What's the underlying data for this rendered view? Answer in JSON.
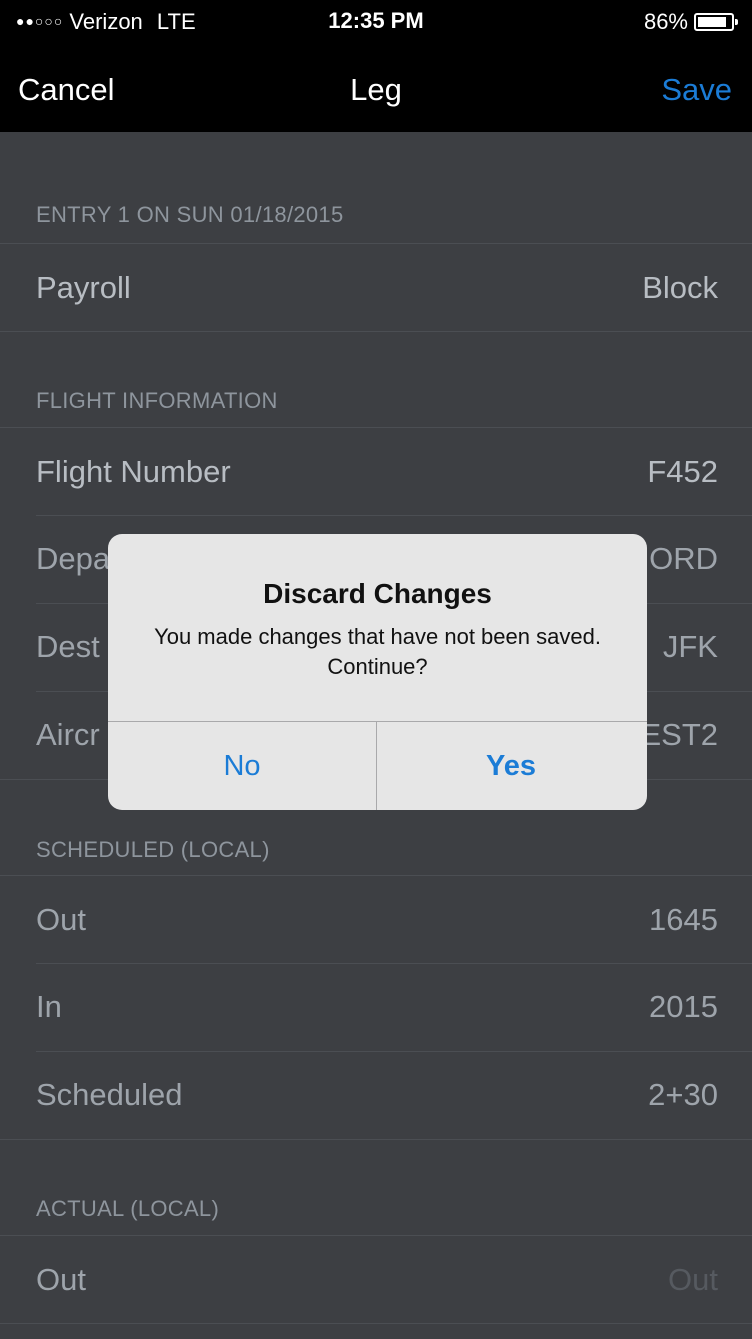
{
  "status_bar": {
    "signal": "●●○○○",
    "carrier": "Verizon",
    "network": "LTE",
    "time": "12:35 PM",
    "battery": "86%",
    "battery_level": 0.86
  },
  "nav": {
    "cancel": "Cancel",
    "title": "Leg",
    "save": "Save"
  },
  "sections": {
    "entry": {
      "header": "ENTRY 1 ON SUN 01/18/2015",
      "payroll_label": "Payroll",
      "payroll_value": "Block"
    },
    "flight": {
      "header": "FLIGHT INFORMATION",
      "flight_number_label": "Flight Number",
      "flight_number_value": "F452",
      "departure_label": "Depa",
      "departure_value": "ORD",
      "destination_label": "Dest",
      "destination_value": "JFK",
      "aircraft_label": "Aircr",
      "aircraft_value": "EST2"
    },
    "scheduled": {
      "header": "SCHEDULED (LOCAL)",
      "out_label": "Out",
      "out_value": "1645",
      "in_label": "In",
      "in_value": "2015",
      "scheduled_label": "Scheduled",
      "scheduled_value": "2+30"
    },
    "actual": {
      "header": "ACTUAL (LOCAL)",
      "out_label": "Out",
      "out_placeholder": "Out"
    }
  },
  "alert": {
    "title": "Discard Changes",
    "message": "You made changes that have not been saved. Continue?",
    "no": "No",
    "yes": "Yes"
  },
  "colors": {
    "accent": "#1b7cd6",
    "background": "#3d3f43",
    "alert_background": "#e6e6e6"
  }
}
